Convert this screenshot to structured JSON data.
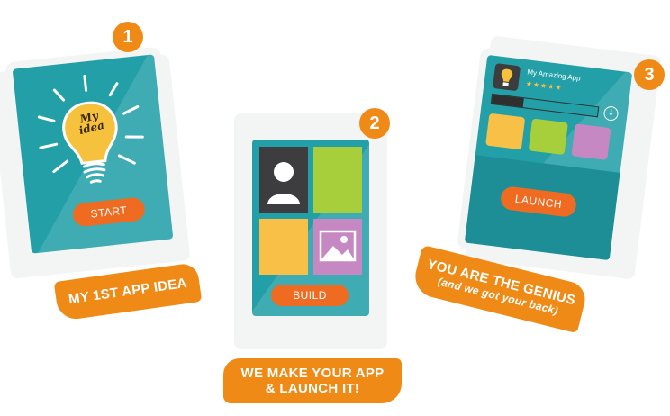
{
  "steps": [
    {
      "number": "1",
      "bulb_text_line1": "My",
      "bulb_text_line2": "idea",
      "button_label": "START",
      "banner_text": "MY 1ST APP IDEA"
    },
    {
      "number": "2",
      "button_label": "BUILD",
      "banner_line1": "WE MAKE YOUR APP",
      "banner_line2": "& LAUNCH IT!"
    },
    {
      "number": "3",
      "app_title": "My Amazing App",
      "rating_stars": "★★★★★",
      "button_label": "LAUNCH",
      "banner_line1": "YOU ARE THE GENIUS",
      "banner_line2": "(and we got your back)"
    }
  ],
  "colors": {
    "teal": "#23a0a7",
    "orange": "#ef8a17",
    "button_orange": "#ef6b21",
    "tile_yellow": "#f8c046",
    "tile_green": "#a7cf3c",
    "tile_purple": "#c688c2",
    "tile_dark": "#3d3d3f"
  },
  "icons": [
    "lightbulb-icon",
    "person-icon",
    "image-icon",
    "download-icon",
    "app-bulb-icon"
  ]
}
